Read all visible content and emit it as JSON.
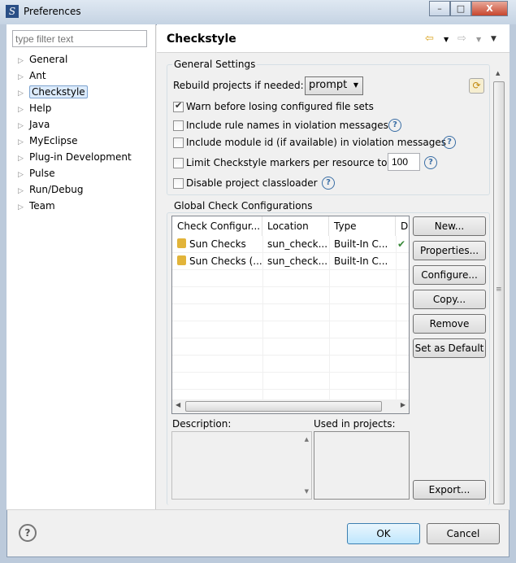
{
  "window": {
    "title": "Preferences",
    "minimize": "–",
    "maximize": "□",
    "close": "X"
  },
  "filter": {
    "placeholder": "type filter text"
  },
  "tree": [
    {
      "label": "General"
    },
    {
      "label": "Ant"
    },
    {
      "label": "Checkstyle",
      "selected": true
    },
    {
      "label": "Help"
    },
    {
      "label": "Java"
    },
    {
      "label": "MyEclipse"
    },
    {
      "label": "Plug-in Development"
    },
    {
      "label": "Pulse"
    },
    {
      "label": "Run/Debug"
    },
    {
      "label": "Team"
    }
  ],
  "page": {
    "title": "Checkstyle",
    "back": "⇦",
    "forward": "⇨",
    "menu": "▼"
  },
  "general": {
    "title": "General Settings",
    "rebuild_label": "Rebuild projects if needed:",
    "rebuild_value": "prompt",
    "options": [
      {
        "label": "Warn before losing configured file sets",
        "checked": true
      },
      {
        "label": "Include rule names in violation messages",
        "checked": false
      },
      {
        "label": "Include module id (if available) in violation messages",
        "checked": false
      },
      {
        "label": "Limit Checkstyle markers per resource to",
        "checked": false,
        "value": "100"
      },
      {
        "label": "Disable project classloader",
        "checked": false
      }
    ]
  },
  "global": {
    "title": "Global Check Configurations",
    "columns": [
      "Check Configur...",
      "Location",
      "Type",
      "D"
    ],
    "rows": [
      {
        "name": "Sun Checks",
        "location": "sun_check...",
        "type": "Built-In C...",
        "default": "✔"
      },
      {
        "name": "Sun Checks (...",
        "location": "sun_check...",
        "type": "Built-In C...",
        "default": ""
      }
    ],
    "buttons": {
      "new": "New...",
      "properties": "Properties...",
      "configure": "Configure...",
      "copy": "Copy...",
      "remove": "Remove",
      "set_default": "Set as Default",
      "export": "Export..."
    },
    "description_label": "Description:",
    "used_label": "Used in projects:"
  },
  "footer": {
    "help": "?",
    "ok": "OK",
    "cancel": "Cancel"
  }
}
